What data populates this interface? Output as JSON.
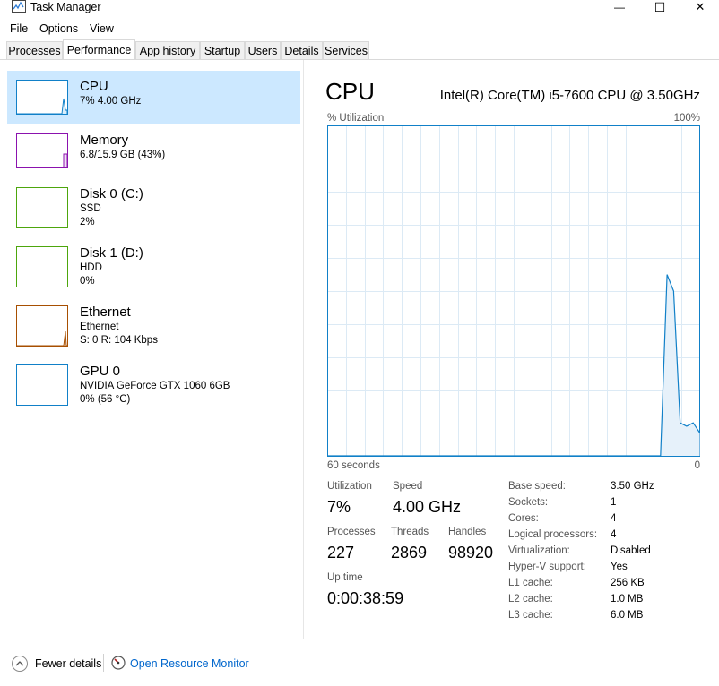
{
  "window": {
    "title": "Task Manager",
    "minimize_glyph": "—",
    "maximize_glyph": "☐",
    "close_glyph": "✕"
  },
  "menu": [
    "File",
    "Options",
    "View"
  ],
  "tabs": [
    "Processes",
    "Performance",
    "App history",
    "Startup",
    "Users",
    "Details",
    "Services"
  ],
  "active_tab": "Performance",
  "resources": [
    {
      "name": "CPU",
      "line1": "7% 4.00 GHz",
      "line2": "",
      "color": "#1180c8",
      "selected": true
    },
    {
      "name": "Memory",
      "line1": "6.8/15.9 GB (43%)",
      "line2": "",
      "color": "#8b12ae",
      "selected": false
    },
    {
      "name": "Disk 0 (C:)",
      "line1": "SSD",
      "line2": "2%",
      "color": "#4da60c",
      "selected": false
    },
    {
      "name": "Disk 1 (D:)",
      "line1": "HDD",
      "line2": "0%",
      "color": "#4da60c",
      "selected": false
    },
    {
      "name": "Ethernet",
      "line1": "Ethernet",
      "line2": "S: 0 R: 104 Kbps",
      "color": "#a74f01",
      "selected": false
    },
    {
      "name": "GPU 0",
      "line1": "NVIDIA GeForce GTX 1060 6GB",
      "line2": "0% (56 °C)",
      "color": "#1180c8",
      "selected": false
    }
  ],
  "detail": {
    "title": "CPU",
    "model": "Intel(R) Core(TM) i5-7600 CPU @ 3.50GHz",
    "graph_label": "% Utilization",
    "graph_max": "100%",
    "graph_time": "60 seconds",
    "graph_zero": "0",
    "stats": {
      "utilization_label": "Utilization",
      "utilization": "7%",
      "speed_label": "Speed",
      "speed": "4.00 GHz",
      "processes_label": "Processes",
      "processes": "227",
      "threads_label": "Threads",
      "threads": "2869",
      "handles_label": "Handles",
      "handles": "98920",
      "uptime_label": "Up time",
      "uptime": "0:00:38:59"
    },
    "specs": [
      {
        "key": "Base speed:",
        "value": "3.50 GHz"
      },
      {
        "key": "Sockets:",
        "value": "1"
      },
      {
        "key": "Cores:",
        "value": "4"
      },
      {
        "key": "Logical processors:",
        "value": "4"
      },
      {
        "key": "Virtualization:",
        "value": "Disabled"
      },
      {
        "key": "Hyper-V support:",
        "value": "Yes"
      },
      {
        "key": "L1 cache:",
        "value": "256 KB"
      },
      {
        "key": "L2 cache:",
        "value": "1.0 MB"
      },
      {
        "key": "L3 cache:",
        "value": "6.0 MB"
      }
    ]
  },
  "cpu_history_percent": [
    0,
    0,
    0,
    0,
    0,
    0,
    0,
    0,
    0,
    0,
    0,
    0,
    0,
    0,
    0,
    0,
    0,
    0,
    0,
    0,
    0,
    0,
    0,
    0,
    0,
    0,
    0,
    0,
    0,
    0,
    0,
    0,
    0,
    0,
    0,
    0,
    0,
    0,
    0,
    0,
    0,
    0,
    0,
    0,
    0,
    0,
    0,
    0,
    0,
    0,
    0,
    0,
    55,
    50,
    10,
    9,
    10,
    7
  ],
  "footer": {
    "fewer": "Fewer details",
    "monitor": "Open Resource Monitor"
  },
  "colors": {
    "cpu": "#1180c8",
    "selected_bg": "#cce8ff",
    "grid": "#dceaf5",
    "link": "#0066cc"
  }
}
